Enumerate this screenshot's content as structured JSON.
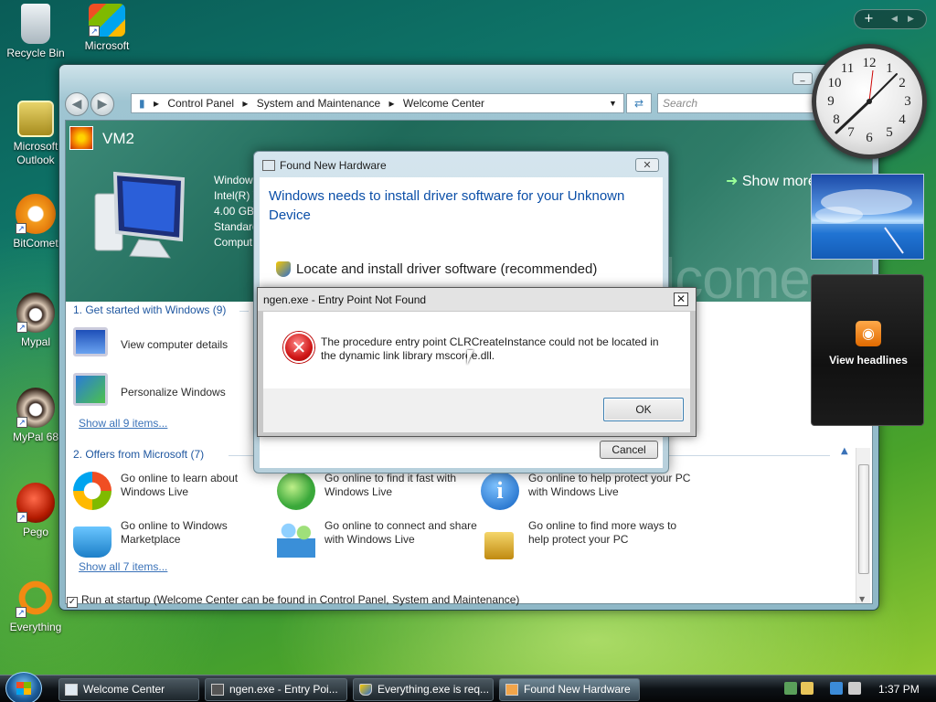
{
  "desktop": {
    "icons": [
      {
        "label": "Recycle Bin"
      },
      {
        "label": "Microsoft"
      },
      {
        "label": "Microsoft Outlook"
      },
      {
        "label": "BitComet"
      },
      {
        "label": "Mypal"
      },
      {
        "label": "MyPal 68"
      },
      {
        "label": "Pego"
      },
      {
        "label": "Everything"
      }
    ]
  },
  "explorer": {
    "breadcrumb": [
      "Control Panel",
      "System and Maintenance",
      "Welcome Center"
    ],
    "search_placeholder": "Search",
    "header": {
      "title": "VM2",
      "sysinfo": [
        "Window",
        "Intel(R) )",
        "4.00 GB I",
        "Standard",
        "Comput"
      ],
      "show_more": "Show more de",
      "watermark": "elcome"
    },
    "section1": {
      "title": "1. Get started with Windows (9)",
      "tasks": [
        "View computer details",
        "Personalize Windows"
      ],
      "show_all": "Show all 9 items..."
    },
    "section2": {
      "title": "2. Offers from Microsoft (7)",
      "tasks": [
        "Go online to learn about Windows Live",
        "Go online to find it fast with Windows Live",
        "Go online to help protect your PC with Windows Live",
        "Go online to Windows Marketplace",
        "Go online to connect and share with Windows Live",
        "Go online to find more ways to help protect your PC"
      ],
      "show_all": "Show all 7 items..."
    },
    "startup": "Run at startup (Welcome Center can be found in Control Panel, System and Maintenance)"
  },
  "found_new_hardware": {
    "title": "Found New Hardware",
    "heading": "Windows needs to install driver software for your Unknown Device",
    "option": "Locate and install driver software (recommended)",
    "cancel": "Cancel"
  },
  "error_dialog": {
    "title": "ngen.exe - Entry Point Not Found",
    "message": "The procedure entry point CLRCreateInstance could not be located in the dynamic link library mscoree.dll.",
    "ok": "OK"
  },
  "gadgets": {
    "rss_label": "View headlines"
  },
  "taskbar": {
    "buttons": [
      "Welcome Center",
      "ngen.exe - Entry Poi...",
      "Everything.exe is req...",
      "Found New Hardware"
    ],
    "time": "1:37 PM"
  },
  "colors": {
    "link": "#3a72b8",
    "heading_blue": "#0b4fa8",
    "error_red": "#d01818"
  }
}
